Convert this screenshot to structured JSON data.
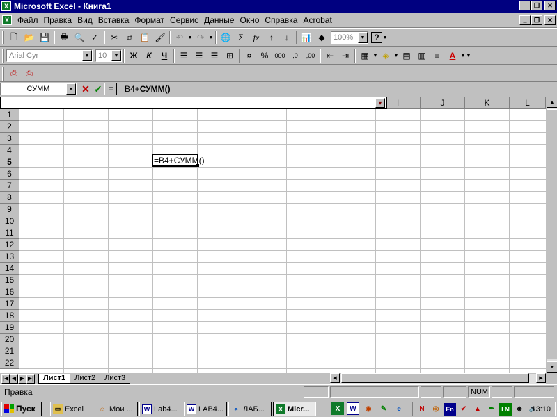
{
  "window": {
    "title": "Microsoft Excel - Книга1",
    "app_icon": "excel-icon"
  },
  "menu": [
    {
      "label": "Файл"
    },
    {
      "label": "Правка"
    },
    {
      "label": "Вид"
    },
    {
      "label": "Вставка"
    },
    {
      "label": "Формат"
    },
    {
      "label": "Сервис"
    },
    {
      "label": "Данные"
    },
    {
      "label": "Окно"
    },
    {
      "label": "Справка"
    },
    {
      "label": "Acrobat"
    }
  ],
  "standard_toolbar": {
    "zoom": "100%"
  },
  "format_toolbar": {
    "font": "Arial Cyr",
    "size": "10",
    "bold": "Ж",
    "italic": "К",
    "underline": "Ч",
    "percent": "%",
    "thousands": "000"
  },
  "formula_bar": {
    "name_box": "СУММ",
    "cancel": "✕",
    "enter": "✓",
    "equals": "=",
    "formula_prefix": "=B4+",
    "formula_fn": "СУММ()"
  },
  "grid": {
    "visible_columns": [
      "I",
      "J",
      "K",
      "L"
    ],
    "rows": [
      "1",
      "2",
      "3",
      "4",
      "5",
      "6",
      "7",
      "8",
      "9",
      "10",
      "11",
      "12",
      "13",
      "14",
      "15",
      "16",
      "17",
      "18",
      "19",
      "20",
      "21",
      "22"
    ],
    "active_row": "5",
    "active_cell_content": "=B4+СУММ()"
  },
  "sheets": [
    {
      "label": "Лист1",
      "active": true
    },
    {
      "label": "Лист2"
    },
    {
      "label": "Лист3"
    }
  ],
  "status": {
    "mode": "Правка",
    "num": "NUM"
  },
  "taskbar": {
    "start": "Пуск",
    "tasks": [
      {
        "label": "Excel"
      },
      {
        "label": "Мои ..."
      },
      {
        "label": "Lab4..."
      },
      {
        "label": "LAB4..."
      },
      {
        "label": "ЛАБ..."
      },
      {
        "label": "Micr..."
      }
    ],
    "clock": "13:10"
  },
  "colors": {
    "title_bg": "#000080",
    "face": "#c0c0c0",
    "excel_green": "#0f7a2a"
  }
}
